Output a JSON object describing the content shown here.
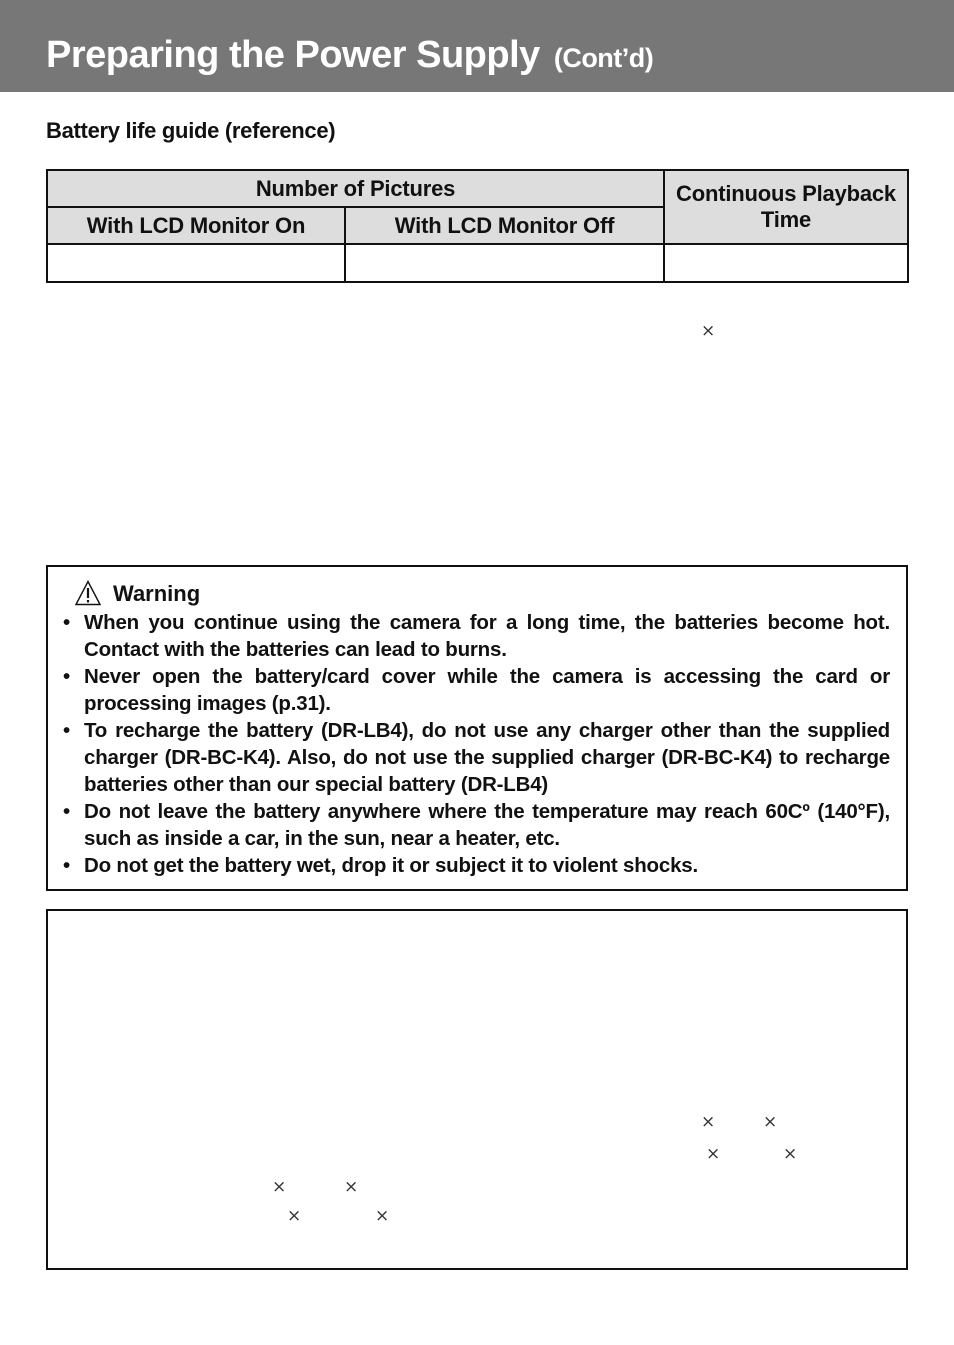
{
  "header": {
    "title": "Preparing the Power Supply",
    "title_suffix": "(Cont’d)",
    "background_color": "#777777"
  },
  "section": {
    "heading": "Battery life guide (reference)"
  },
  "battery_table": {
    "group_header": "Number of Pictures",
    "columns": [
      "With LCD Monitor On",
      "With LCD Monitor Off",
      "Continuous Playback Time"
    ],
    "rows": [
      [
        "",
        "",
        ""
      ]
    ],
    "header_background": "#dddddd"
  },
  "stray_marks": {
    "glyph": "×"
  },
  "warning": {
    "icon": "warning-triangle-icon",
    "title": "Warning",
    "bullet": "•",
    "items": [
      "When you continue using the camera for a long time, the batteries become hot. Contact with the batteries can lead to burns.",
      "Never open the battery/card cover while the camera is accessing the card or processing images (p.31).",
      "To recharge the battery (DR-LB4), do not use any charger other than the supplied charger (DR-BC-K4). Also, do not use the supplied charger (DR-BC-K4) to recharge batteries other than our special battery (DR-LB4)",
      "Do not leave the battery anywhere where the temperature may reach 60Cº (140°F), such as inside a car, in the sun, near a heater, etc.",
      "Do not get the battery wet, drop it or subject it to violent shocks."
    ]
  }
}
